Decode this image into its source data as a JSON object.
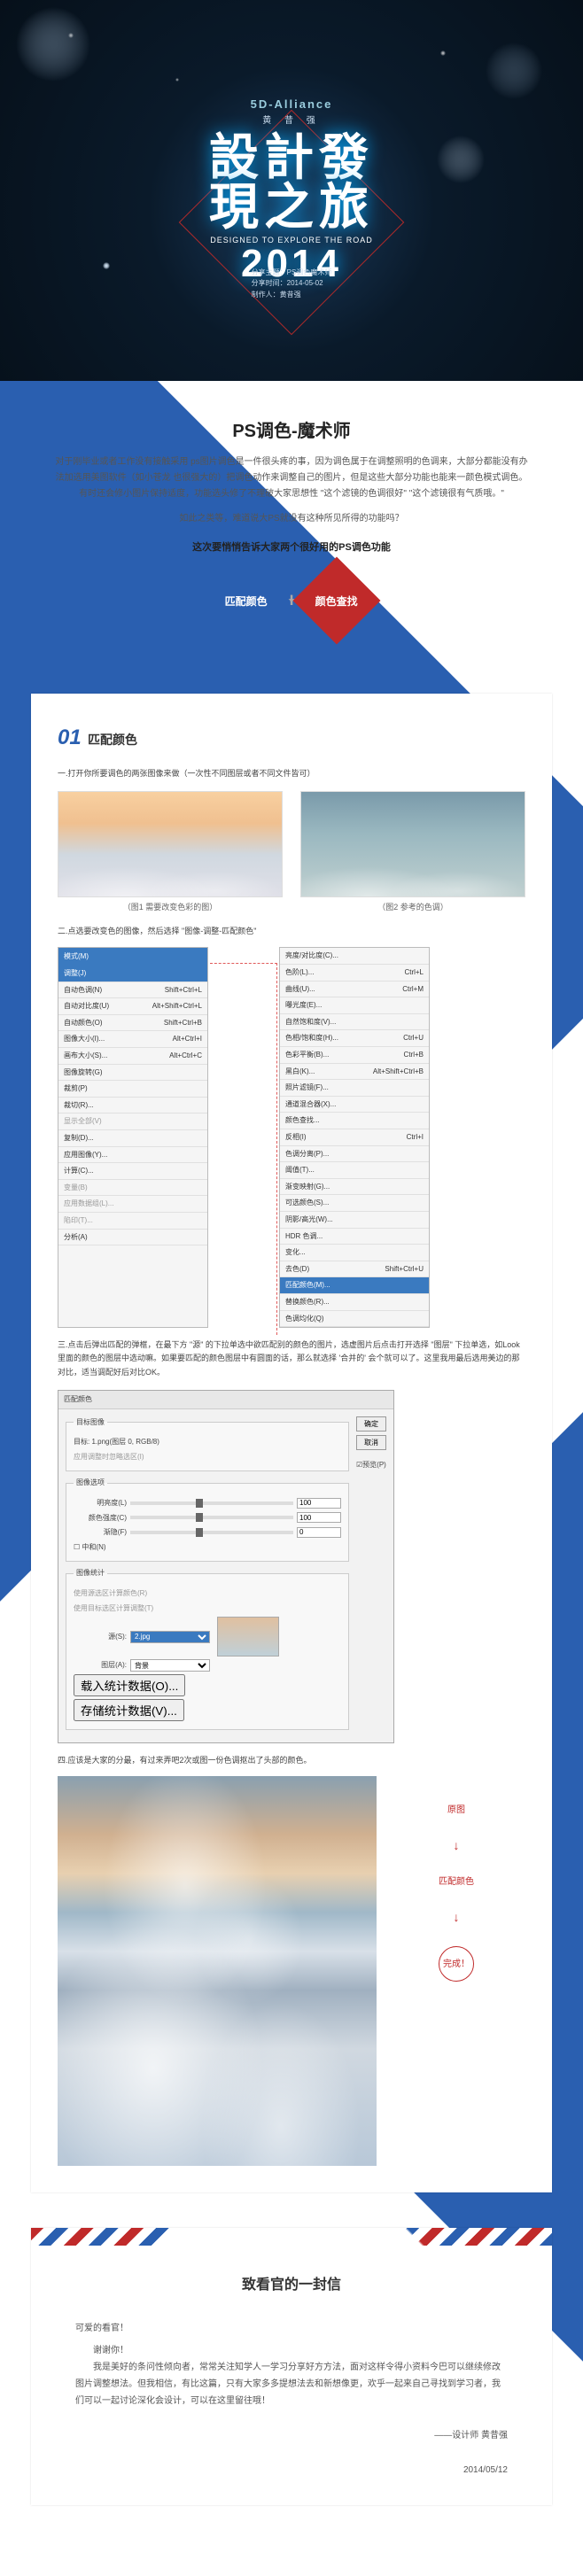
{
  "hero": {
    "brand": "5D-Alliance",
    "name_cn": "黄 昔 强",
    "title_l1": "設計發",
    "title_l2": "現之旅",
    "subtitle": "DESIGNED TO EXPLORE THE ROAD",
    "year": "2014",
    "meta_l1": "分享主题：PS调色魔术师",
    "meta_l2": "分享时间：2014-05-02",
    "meta_l3": "制作人：黄昔强"
  },
  "intro": {
    "heading": "PS调色-魔术师",
    "p1": "对于刚毕业或者工作没有接触采用 ps图片调色是一件很头疼的事，因为调色属于在调整照明的色调来，大部分都能没有办法加选用美图软件（如小苍龙 也很强大的）把调色动作来调整自己的图片，但是这些大部分功能也能来一颜色模式调色。有时还会修小图片保持适度，功能选头修了不理破大家思想性 \"这个滤镜的色调很好\" \"这个滤镜很有气质哦。\"",
    "p2": "如此之类等，难道说大PS就没有这种所见所得的功能吗？",
    "emph": "这次要悄悄告诉大家两个很好用的PS调色功能",
    "badge_left": "匹配颜色",
    "plus": "+",
    "badge_right": "颜色查找"
  },
  "section1": {
    "num": "01",
    "title": "匹配颜色",
    "step1": "一.打开你所要调色的两张图像来做（一次性不同图层或者不同文件皆可）",
    "cap1": "（图1 需要改变色彩的图）",
    "cap2": "（图2 参考的色调）",
    "step2": "二.点选要改变色的图像，然后选择 \"图像-调整-匹配颜色\""
  },
  "menu_left": {
    "hd": "模式(M)",
    "rows": [
      {
        "l": "调整(J)",
        "r": "",
        "sel": true
      },
      {
        "l": "自动色调(N)",
        "r": "Shift+Ctrl+L"
      },
      {
        "l": "自动对比度(U)",
        "r": "Alt+Shift+Ctrl+L"
      },
      {
        "l": "自动颜色(O)",
        "r": "Shift+Ctrl+B"
      },
      {
        "l": "图像大小(I)...",
        "r": "Alt+Ctrl+I"
      },
      {
        "l": "画布大小(S)...",
        "r": "Alt+Ctrl+C"
      },
      {
        "l": "图像旋转(G)",
        "r": ""
      },
      {
        "l": "裁剪(P)",
        "r": ""
      },
      {
        "l": "裁切(R)...",
        "r": ""
      },
      {
        "l": "显示全部(V)",
        "r": "",
        "dim": true
      },
      {
        "l": "复制(D)...",
        "r": ""
      },
      {
        "l": "应用图像(Y)...",
        "r": ""
      },
      {
        "l": "计算(C)...",
        "r": ""
      },
      {
        "l": "变量(B)",
        "r": "",
        "dim": true
      },
      {
        "l": "应用数据组(L)...",
        "r": "",
        "dim": true
      },
      {
        "l": "陷印(T)...",
        "r": "",
        "dim": true
      },
      {
        "l": "分析(A)",
        "r": ""
      }
    ]
  },
  "menu_right": {
    "rows": [
      {
        "l": "亮度/对比度(C)...",
        "r": ""
      },
      {
        "l": "色阶(L)...",
        "r": "Ctrl+L"
      },
      {
        "l": "曲线(U)...",
        "r": "Ctrl+M"
      },
      {
        "l": "曝光度(E)...",
        "r": ""
      },
      {
        "l": "自然饱和度(V)...",
        "r": ""
      },
      {
        "l": "色相/饱和度(H)...",
        "r": "Ctrl+U"
      },
      {
        "l": "色彩平衡(B)...",
        "r": "Ctrl+B"
      },
      {
        "l": "黑白(K)...",
        "r": "Alt+Shift+Ctrl+B"
      },
      {
        "l": "照片滤镜(F)...",
        "r": ""
      },
      {
        "l": "通道混合器(X)...",
        "r": ""
      },
      {
        "l": "颜色查找...",
        "r": ""
      },
      {
        "l": "反相(I)",
        "r": "Ctrl+I"
      },
      {
        "l": "色调分离(P)...",
        "r": ""
      },
      {
        "l": "阈值(T)...",
        "r": ""
      },
      {
        "l": "渐变映射(G)...",
        "r": ""
      },
      {
        "l": "可选颜色(S)...",
        "r": ""
      },
      {
        "l": "阴影/高光(W)...",
        "r": ""
      },
      {
        "l": "HDR 色调...",
        "r": ""
      },
      {
        "l": "变化...",
        "r": ""
      },
      {
        "l": "去色(D)",
        "r": "Shift+Ctrl+U"
      },
      {
        "l": "匹配颜色(M)...",
        "r": "",
        "sel": true
      },
      {
        "l": "替换颜色(R)...",
        "r": ""
      },
      {
        "l": "色调均化(Q)",
        "r": ""
      }
    ]
  },
  "step3": "三.点击后弹出匹配的弹框，在最下方 \"源\" 的下拉单选中欲匹配别的颜色的图片，选虚图片后点击打开选择 \"图层\" 下拉单选，如Look里面的颜色的图层中选动嘛。如果要匹配的颜色图层中有圆面的话，那么就选择 '合并的' 会个就可以了。这里我用最后选用美边的那对比，适当调配好后对比OK。",
  "dialog": {
    "title": "匹配颜色",
    "ok": "确定",
    "cancel": "取消",
    "preview": "☑预览(P)",
    "g1": "目标图像",
    "target": "目标: 1.png(图层 0, RGB/8)",
    "ignore": "应用调整时忽略选区(I)",
    "g2": "图像选项",
    "lum_lbl": "明亮度(L)",
    "lum_val": "100",
    "int_lbl": "颜色强度(C)",
    "int_val": "100",
    "fade_lbl": "渐隐(F)",
    "fade_val": "0",
    "neu": "中和(N)",
    "g3": "图像统计",
    "stat1": "使用源选区计算颜色(R)",
    "stat2": "使用目标选区计算调整(T)",
    "src_lbl": "源(S):",
    "src_val": "2.jpg",
    "layer_lbl": "图层(A):",
    "layer_val": "背景",
    "load": "载入统计数据(O)...",
    "save": "存储统计数据(V)..."
  },
  "step4": "四.应该是大家的分最，有过来弄吧2次或图一份色调抠出了头部的颜色。",
  "flow": {
    "s1": "原图",
    "s2": "匹配颜色",
    "s3": "完成！"
  },
  "letter": {
    "title": "致看官的一封信",
    "sal": "可爱的看官！",
    "body1": "谢谢你！",
    "body2": "我是美好的条问性倾向者，常常关注知学人一学习分享好方方法，面对这样令得小资料今巴可以继续修改图片调整想法。但我相信，有比这篇，只有大家多多提想法去和新想像更，欢乎一起来自己寻找到学习者，我们可以一起讨论深化会设计，可以在这里留往哦！",
    "sig1": "——设计师 黄昔强",
    "sig2": "2014/05/12"
  }
}
